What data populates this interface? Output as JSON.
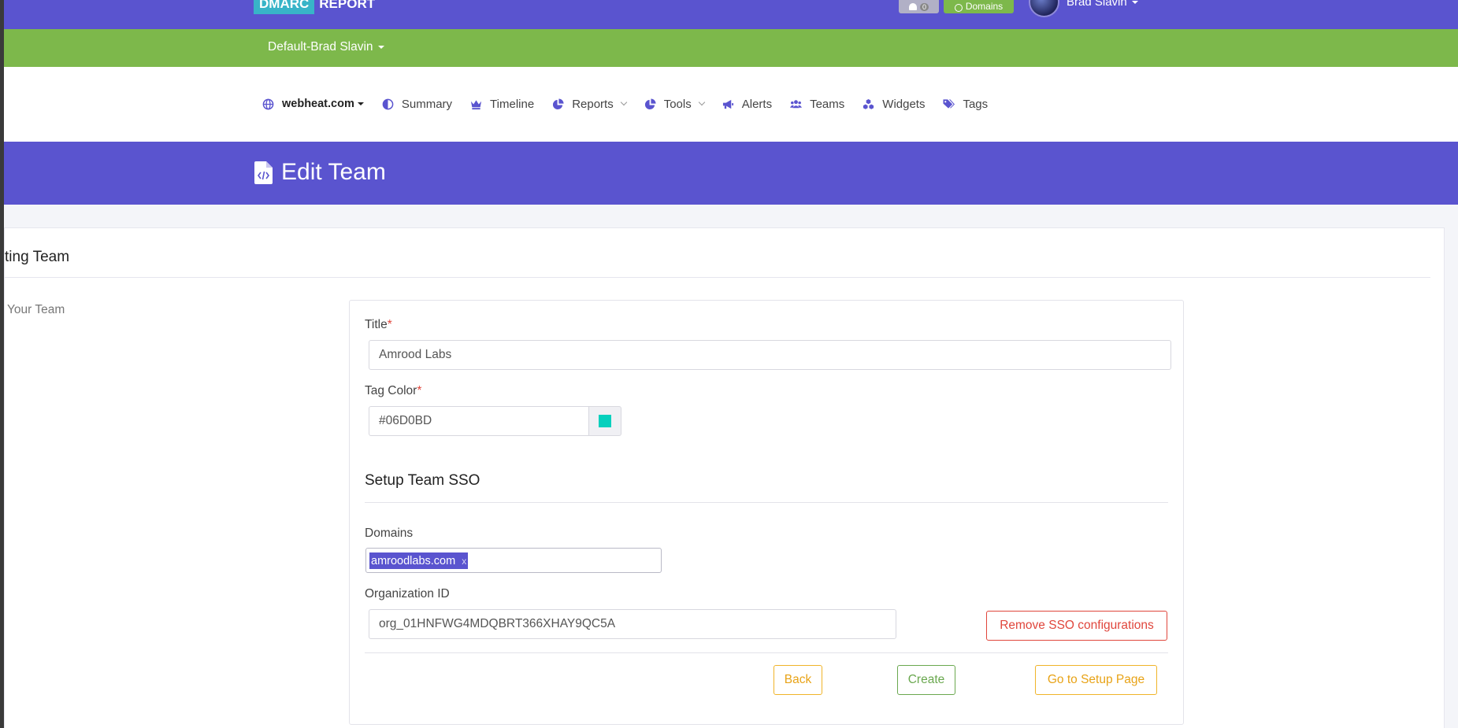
{
  "header": {
    "logo_left": "DMARC",
    "logo_right": "REPORT",
    "notification_count": "0",
    "domains_label": "Domains",
    "user_name": "Brad Slavin"
  },
  "account": {
    "label": "Default-Brad Slavin"
  },
  "nav": {
    "domain": "webheat.com",
    "summary": "Summary",
    "timeline": "Timeline",
    "reports": "Reports",
    "tools": "Tools",
    "alerts": "Alerts",
    "teams": "Teams",
    "widgets": "Widgets",
    "tags": "Tags"
  },
  "page": {
    "title": "Edit Team"
  },
  "card": {
    "title": "ting Team",
    "side_label": "Your Team"
  },
  "form": {
    "title_label": "Title",
    "title_value": "Amrood Labs",
    "tag_color_label": "Tag Color",
    "tag_color_value": "#06D0BD",
    "required_mark": "*",
    "sso_section_title": "Setup Team SSO",
    "domains_label": "Domains",
    "domain_tags": [
      "amroodlabs.com"
    ],
    "tag_remove": "x",
    "org_id_label": "Organization ID",
    "org_id_value": "org_01HNFWG4MDQBRT366XHAY9QC5A",
    "remove_sso_button": "Remove SSO configurations",
    "back_button": "Back",
    "create_button": "Create",
    "setup_page_button": "Go to Setup Page"
  },
  "colors": {
    "primary": "#5a54cf",
    "green": "#7db84b",
    "teal": "#38b4c8",
    "danger": "#e0463c",
    "warning": "#f0b429",
    "tag_color": "#06D0BD"
  }
}
